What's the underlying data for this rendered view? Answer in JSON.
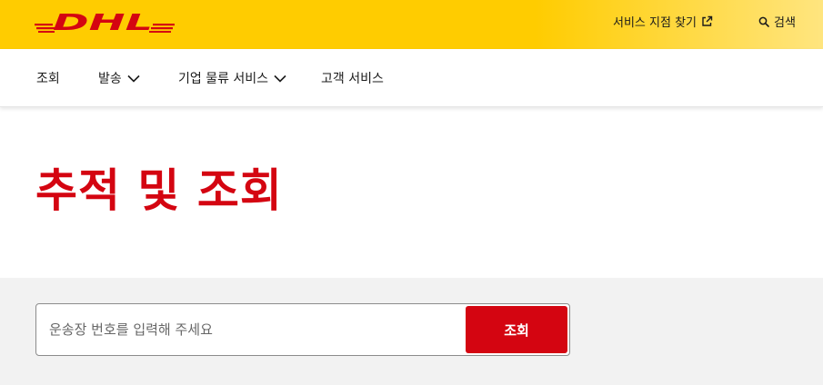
{
  "brand": {
    "logo_text": "DHL",
    "brand_yellow": "#ffcc00",
    "brand_red": "#d40511"
  },
  "header": {
    "service_points_label": "서비스 지점 찾기",
    "service_points_icon": "external-link-icon",
    "search_label": "검색",
    "search_icon": "search-icon"
  },
  "nav": {
    "items": [
      {
        "label": "조회",
        "has_dropdown": false
      },
      {
        "label": "발송",
        "has_dropdown": true
      },
      {
        "label": "기업 물류 서비스",
        "has_dropdown": true
      },
      {
        "label": "고객 서비스",
        "has_dropdown": false
      }
    ]
  },
  "page": {
    "title": "추적 및 조회"
  },
  "tracking": {
    "input_placeholder": "운송장 번호를 입력해 주세요",
    "input_value": "",
    "button_label": "조회"
  }
}
